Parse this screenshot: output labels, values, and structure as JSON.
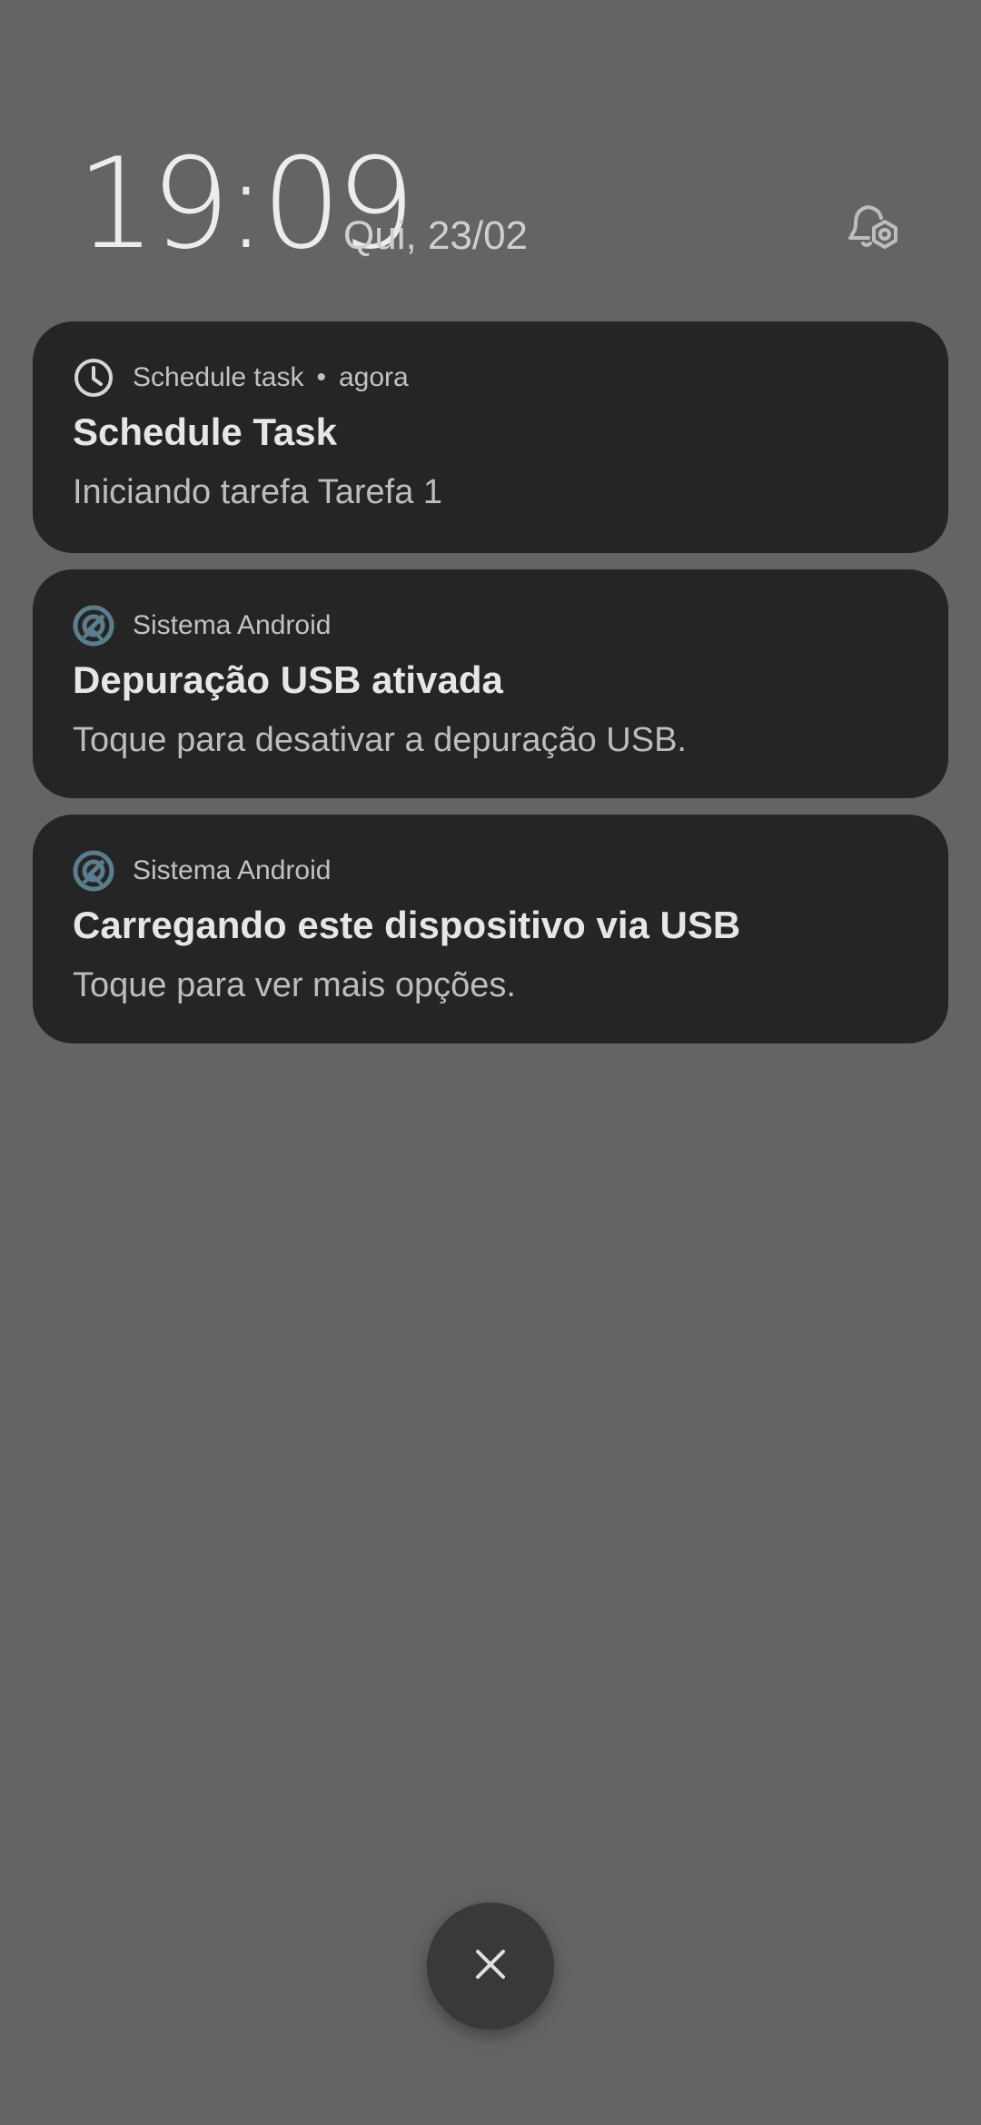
{
  "lockscreen": {
    "time": "19:09",
    "date": "Qui, 23/02",
    "icons": {
      "notification_settings": "bell-gear-icon"
    }
  },
  "notifications": [
    {
      "app": "Schedule task",
      "separator": "•",
      "time": "agora",
      "title": "Schedule Task",
      "body": "Iniciando tarefa Tarefa 1",
      "icon": "clock-icon"
    },
    {
      "app": "Sistema Android",
      "title": "Depuração USB ativada",
      "body": "Toque para desativar a depuração USB.",
      "icon": "android-system-icon"
    },
    {
      "app": "Sistema Android",
      "title": "Carregando este dispositivo via USB",
      "body": "Toque para ver mais opções.",
      "icon": "android-system-icon"
    }
  ],
  "controls": {
    "clear_all_icon": "close-icon"
  },
  "colors": {
    "background": "#646464",
    "card": "#252525",
    "accent_icon": "#5b7d8c"
  }
}
